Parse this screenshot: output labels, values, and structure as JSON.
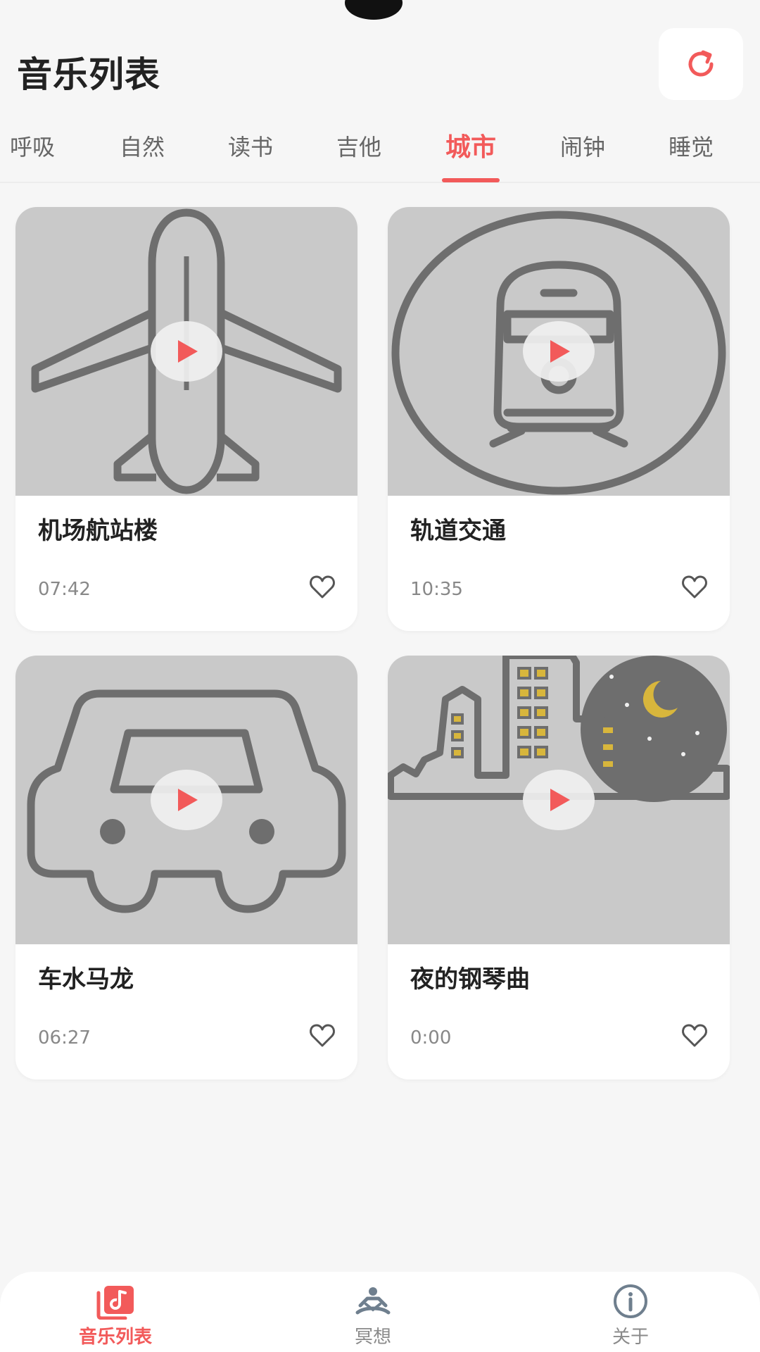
{
  "header": {
    "title": "音乐列表",
    "refresh_icon": "refresh-icon"
  },
  "tabs": [
    {
      "label": "呼吸",
      "active": false
    },
    {
      "label": "自然",
      "active": false
    },
    {
      "label": "读书",
      "active": false
    },
    {
      "label": "吉他",
      "active": false
    },
    {
      "label": "城市",
      "active": true
    },
    {
      "label": "闹钟",
      "active": false
    },
    {
      "label": "睡觉",
      "active": false
    }
  ],
  "cards": [
    {
      "title": "机场航站楼",
      "duration": "07:42",
      "image_icon": "airplane-icon"
    },
    {
      "title": "轨道交通",
      "duration": "10:35",
      "image_icon": "train-icon"
    },
    {
      "title": "车水马龙",
      "duration": "06:27",
      "image_icon": "car-icon"
    },
    {
      "title": "夜的钢琴曲",
      "duration": "0:00",
      "image_icon": "night-city-icon"
    }
  ],
  "bottom_nav": [
    {
      "label": "音乐列表",
      "icon": "music-library-icon",
      "active": true
    },
    {
      "label": "冥想",
      "icon": "meditation-icon",
      "active": false
    },
    {
      "label": "关于",
      "icon": "info-icon",
      "active": false
    }
  ],
  "colors": {
    "accent": "#f25a5a",
    "card_image_bg": "#c9c9c9",
    "icon_gray": "#6e6e6e",
    "window_yellow": "#d8b63c"
  }
}
